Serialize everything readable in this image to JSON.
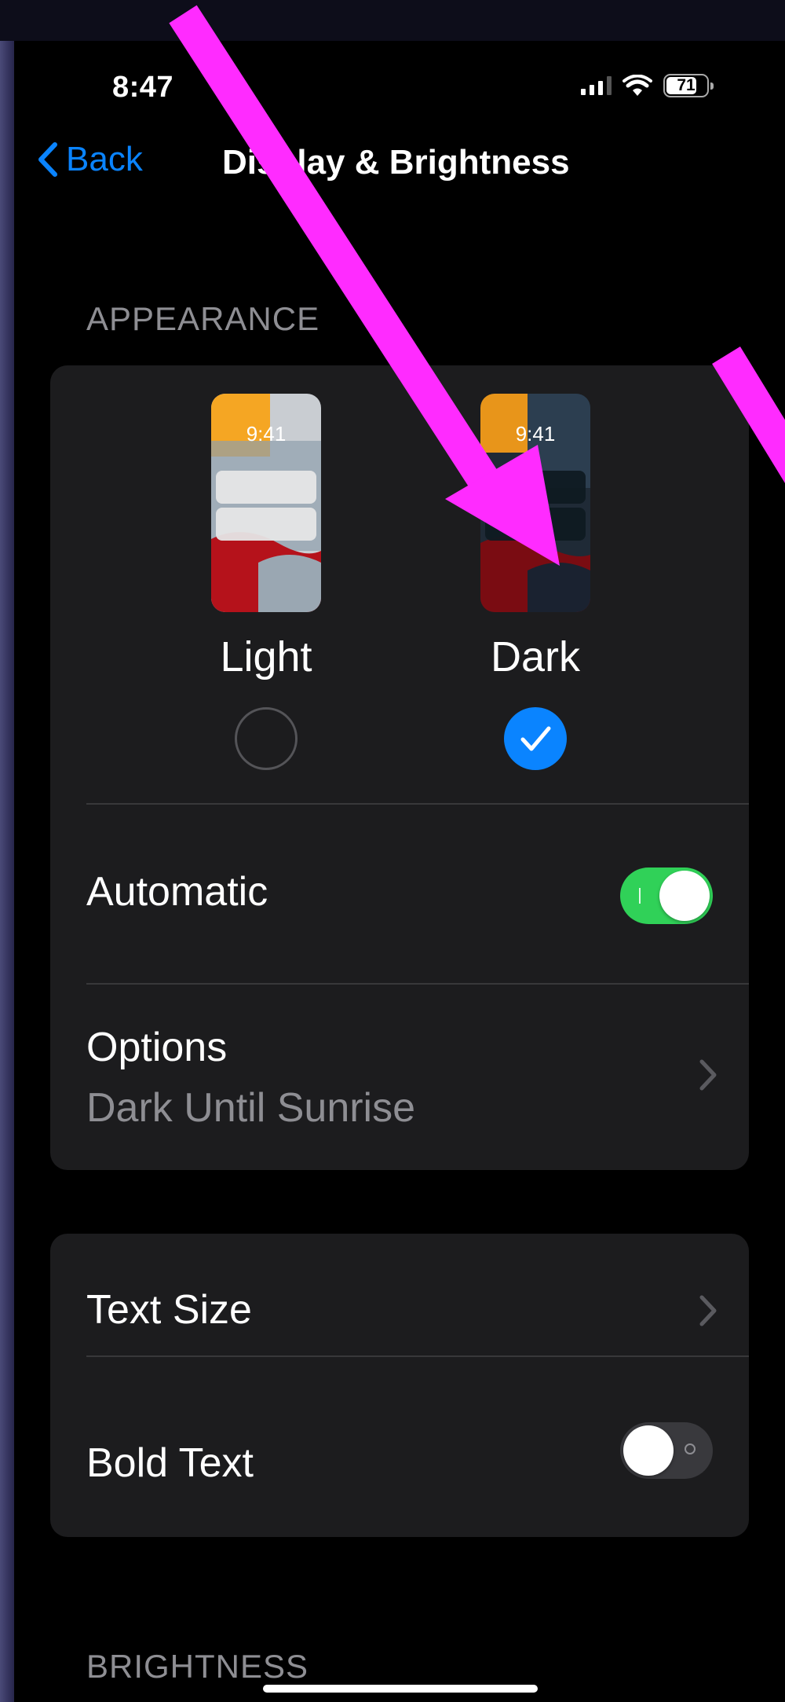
{
  "status_bar": {
    "time": "8:47",
    "battery": "71",
    "icons": [
      "signal-icon",
      "wifi-icon",
      "battery-icon"
    ]
  },
  "nav": {
    "back_label": "Back",
    "title": "Display & Brightness"
  },
  "appearance": {
    "header": "APPEARANCE",
    "options": [
      {
        "label": "Light",
        "preview_time": "9:41",
        "selected": false
      },
      {
        "label": "Dark",
        "preview_time": "9:41",
        "selected": true
      }
    ],
    "automatic": {
      "label": "Automatic",
      "on": true
    },
    "options_row": {
      "label": "Options",
      "value": "Dark Until Sunrise"
    }
  },
  "text": {
    "text_size_label": "Text Size",
    "bold_text": {
      "label": "Bold Text",
      "on": false
    }
  },
  "brightness": {
    "header": "BRIGHTNESS"
  },
  "colors": {
    "accent": "#0a84ff",
    "toggle_on": "#30d158",
    "toggle_off": "#39393d",
    "card_bg": "#1c1c1e",
    "annotation_arrow": "#ff2bff"
  }
}
